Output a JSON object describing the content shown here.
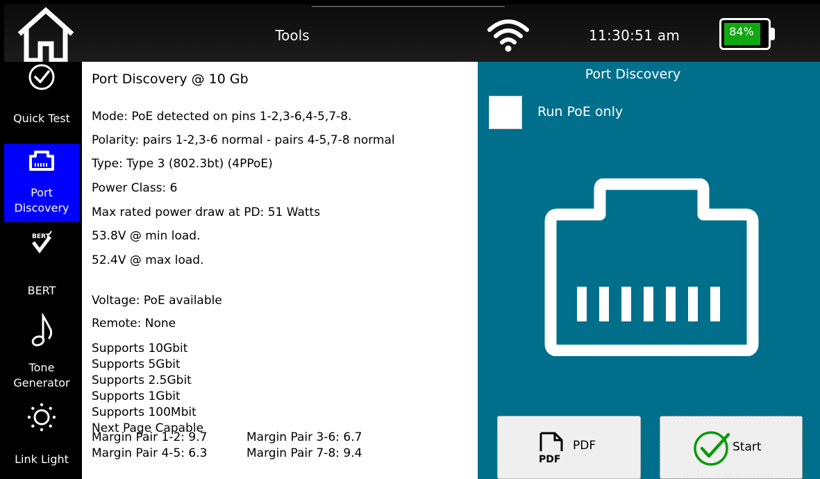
{
  "header": {
    "title": "Tools",
    "time": "11:30:51 am",
    "battery_percent": "84%",
    "battery_level": 0.84,
    "battery_color": "#12a812"
  },
  "sidebar": {
    "items": [
      {
        "label": "Quick Test",
        "icon": "checkmark-circle-icon"
      },
      {
        "label": "Port\nDiscovery",
        "label_lines": [
          "Port",
          "Discovery"
        ],
        "icon": "ethernet-port-icon",
        "active": true
      },
      {
        "label": "BERT",
        "icon": "bert-check-icon",
        "icon_text": "BERT"
      },
      {
        "label": "Tone\nGenerator",
        "label_lines": [
          "Tone",
          "Generator"
        ],
        "icon": "music-note-icon"
      },
      {
        "label": "Link Light",
        "icon": "light-bulb-icon"
      }
    ],
    "active_color": "#0000ff"
  },
  "content": {
    "heading": "Port Discovery @ 10 Gb",
    "lines": [
      "Mode: PoE detected on pins 1-2,3-6,4-5,7-8.",
      "Polarity: pairs 1-2,3-6 normal - pairs 4-5,7-8 normal",
      "Type: Type 3 (802.3bt) (4PPoE)",
      "Power Class: 6",
      "Max rated power draw at PD: 51 Watts",
      "53.8V @ min load.",
      "52.4V @ max load."
    ],
    "voltage": "Voltage: PoE available",
    "remote": "Remote: None",
    "supports": [
      "Supports 10Gbit",
      "Supports 5Gbit",
      "Supports 2.5Gbit",
      "Supports 1Gbit",
      "Supports 100Mbit",
      "Next Page Capable"
    ],
    "margins": [
      "Margin Pair 1-2: 9.7",
      "Margin Pair 3-6: 6.7",
      "Margin Pair 4-5: 6.3",
      "Margin Pair 7-8: 9.4"
    ]
  },
  "panel": {
    "title": "Port Discovery",
    "checkbox_label": "Run PoE only",
    "checkbox_checked": false,
    "pdf_label": "PDF",
    "pdf_icon_text": "PDF",
    "start_label": "Start",
    "background": "#006f8c"
  }
}
